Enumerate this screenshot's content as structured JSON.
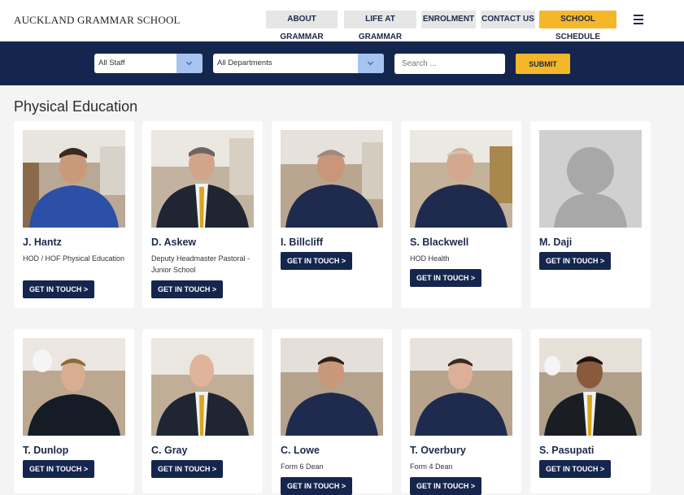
{
  "header": {
    "logo_text": "Auckland Grammar School",
    "nav": [
      {
        "label": "ABOUT GRAMMAR"
      },
      {
        "label": "LIFE AT GRAMMAR"
      },
      {
        "label": "ENROLMENT"
      },
      {
        "label": "CONTACT US"
      },
      {
        "label": "SCHOOL SCHEDULE"
      }
    ]
  },
  "filters": {
    "staff_selected": "All Staff",
    "department_selected": "All Departments",
    "search_placeholder": "Search ...",
    "submit_label": "SUBMIT"
  },
  "section": {
    "title": "Physical Education"
  },
  "cta_label": "GET IN TOUCH >",
  "staff": [
    {
      "name": "J. Hantz",
      "role": "HOD / HOF Physical Education"
    },
    {
      "name": "D. Askew",
      "role": "Deputy Headmaster Pastoral - Junior School"
    },
    {
      "name": "I. Billcliff",
      "role": ""
    },
    {
      "name": "S. Blackwell",
      "role": "HOD Health"
    },
    {
      "name": "M. Daji",
      "role": ""
    },
    {
      "name": "T. Dunlop",
      "role": ""
    },
    {
      "name": "C. Gray",
      "role": ""
    },
    {
      "name": "C. Lowe",
      "role": "Form 6 Dean"
    },
    {
      "name": "T. Overbury",
      "role": "Form 4 Dean"
    },
    {
      "name": "S. Pasupati",
      "role": ""
    }
  ],
  "colors": {
    "navy": "#15264e",
    "accent": "#f5b72a",
    "select_arrow": "#a7c4f0"
  }
}
